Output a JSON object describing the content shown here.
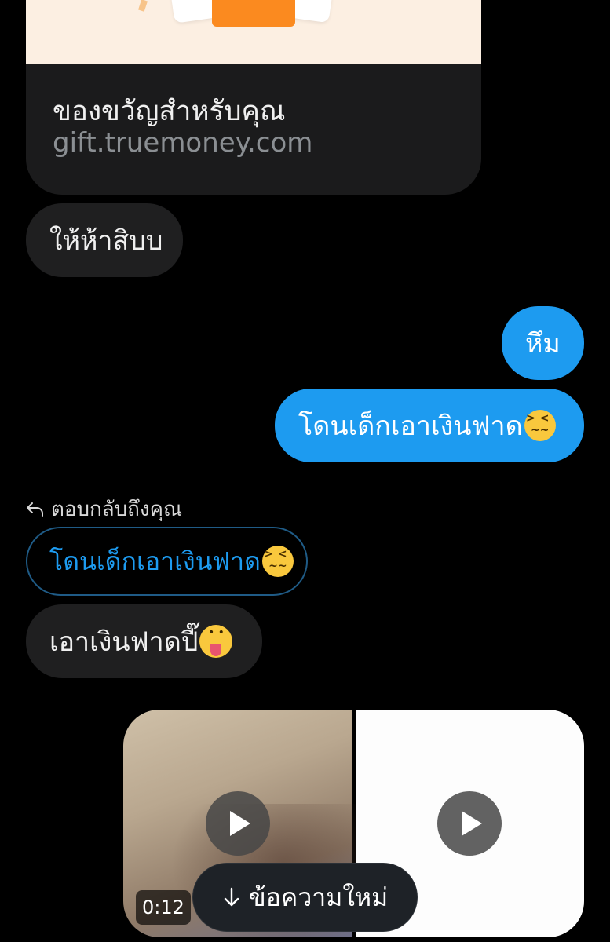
{
  "link_card": {
    "title": "ของขวัญสำหรับคุณ",
    "url": "gift.truemoney.com"
  },
  "messages": [
    {
      "direction": "incoming",
      "text": "ให้ห้าสิบบ"
    },
    {
      "direction": "outgoing",
      "text": "หึม"
    },
    {
      "direction": "outgoing",
      "text": "โดนเด็กเอาเงินฟาด",
      "emoji": "confounded-face-emoji"
    },
    {
      "direction": "incoming",
      "reply_label": "ตอบกลับถึงคุณ",
      "quoted_text": "โดนเด็กเอาเงินฟาด",
      "quoted_emoji": "confounded-face-emoji",
      "text": "เอาเงินฟาดปี๊",
      "emoji": "tongue-face-emoji"
    }
  ],
  "media": {
    "video_duration": "0:12",
    "icons": [
      "play-icon",
      "play-icon"
    ]
  },
  "new_messages_button": {
    "icon": "arrow-down-icon",
    "label": "ข้อความใหม่"
  },
  "colors": {
    "background": "#000000",
    "incoming_bubble": "#1f1f20",
    "outgoing_bubble": "#1d9bf0",
    "reply_border": "#1f5b86",
    "accent": "#1d9bf0"
  }
}
